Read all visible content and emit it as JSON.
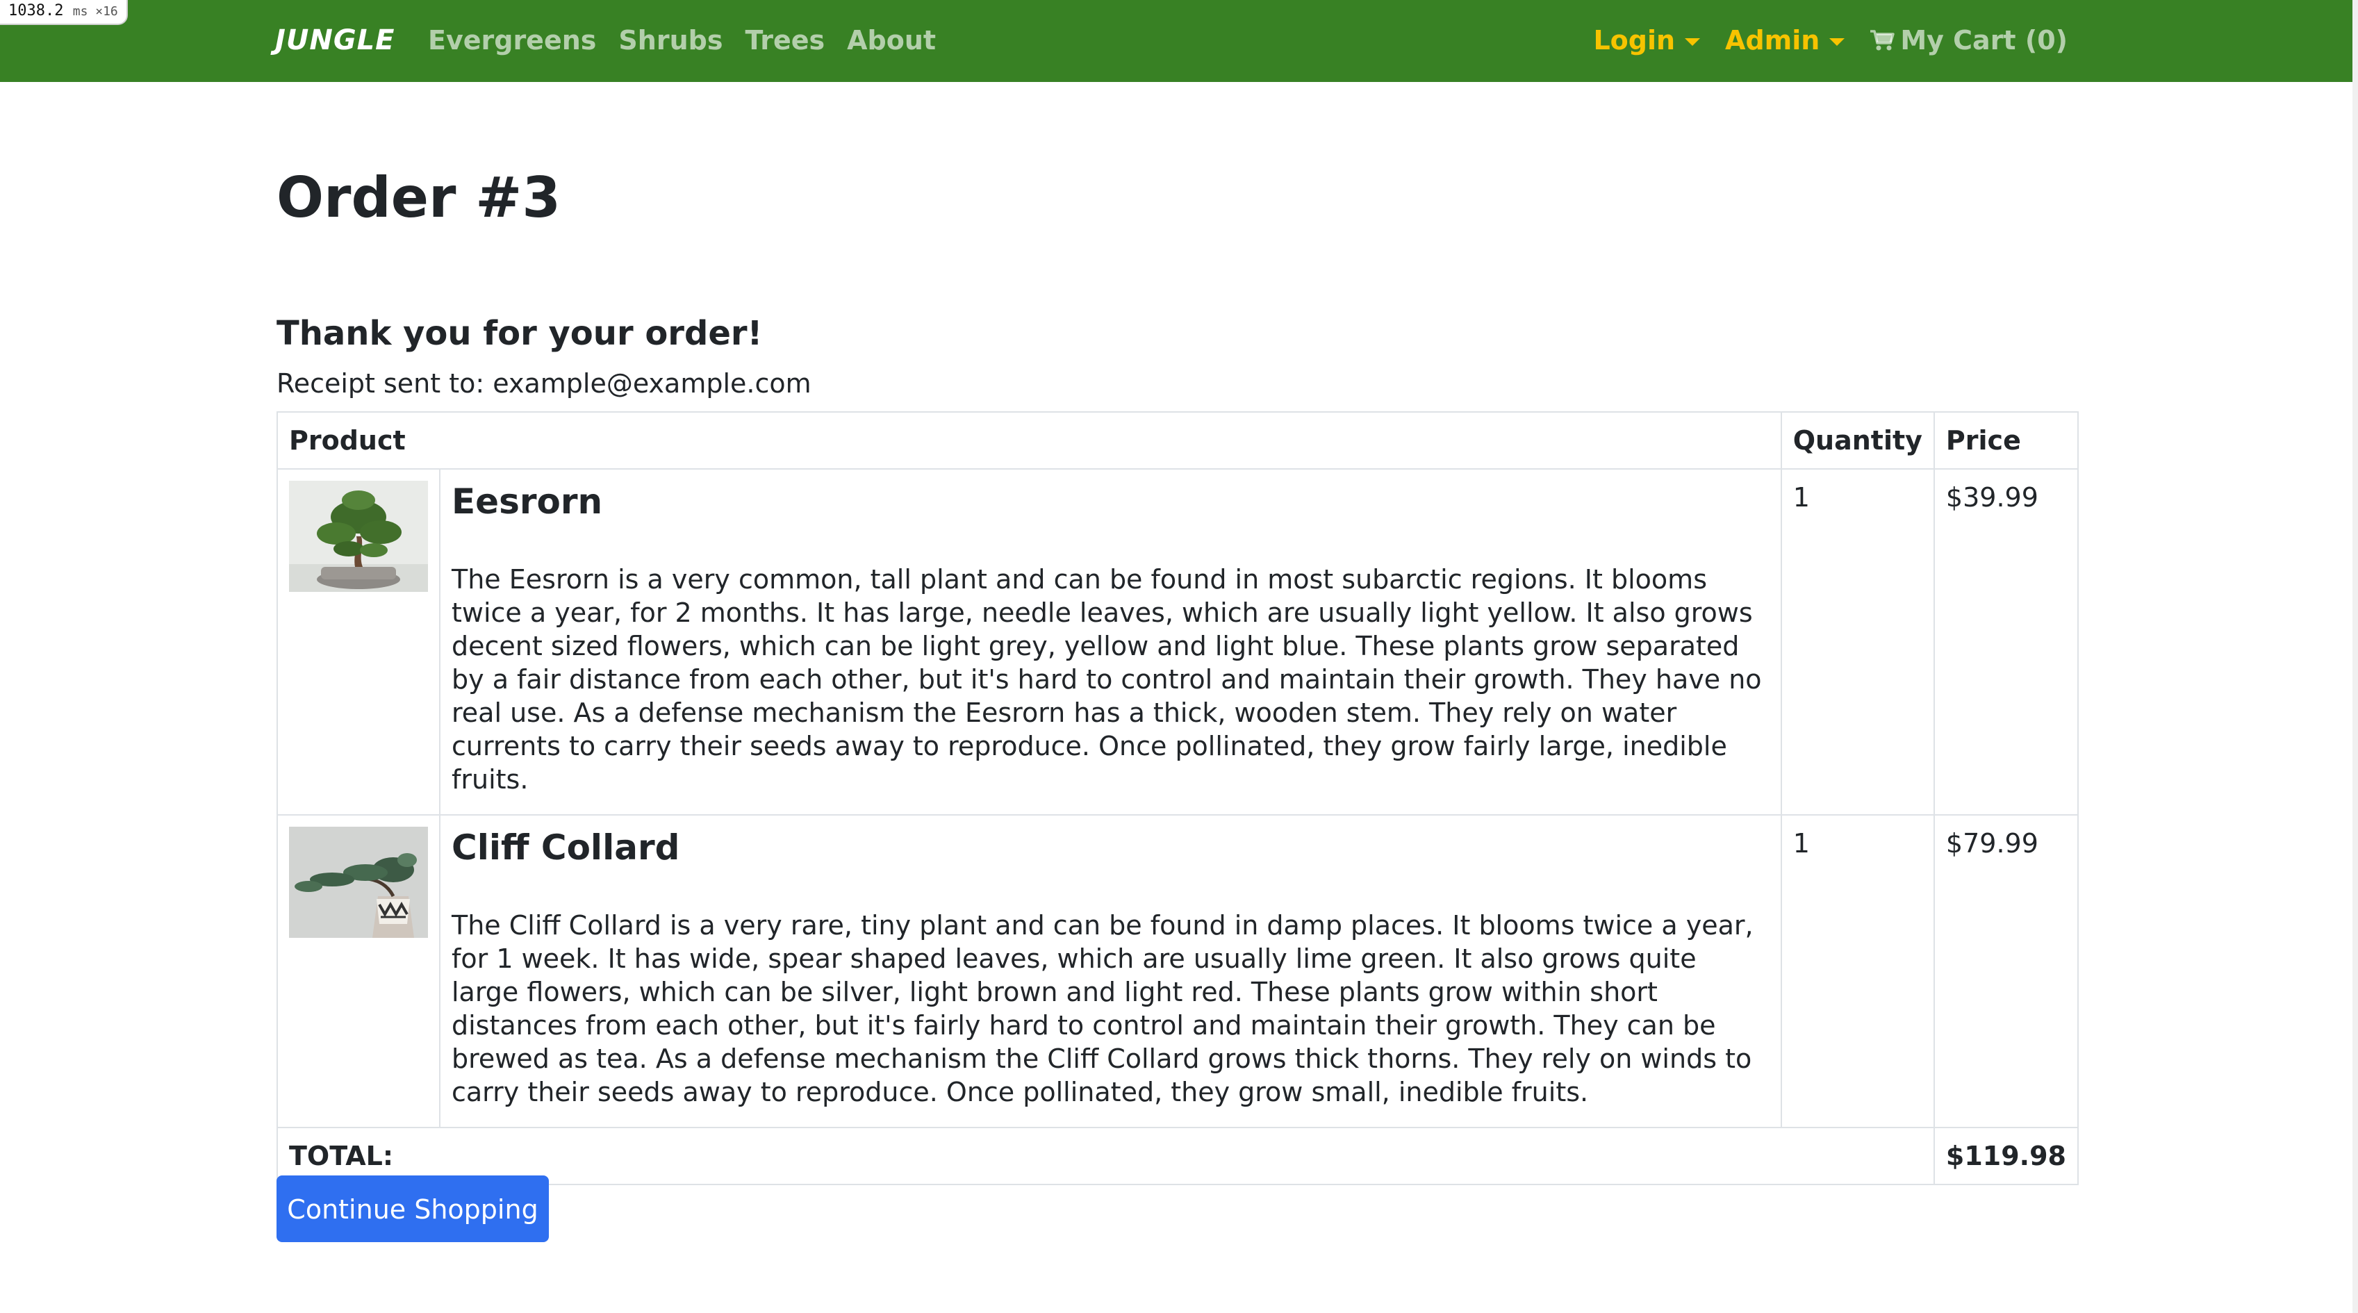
{
  "perf": {
    "value": "1038.2",
    "unit": "ms ×16"
  },
  "nav": {
    "brand": "JUNGLE",
    "links": [
      "Evergreens",
      "Shrubs",
      "Trees",
      "About"
    ],
    "login": "Login",
    "admin": "Admin",
    "cart": "My Cart (0)"
  },
  "colors": {
    "navbar": "#388124",
    "dropdown": "#f7c300",
    "button": "#2f6ff0"
  },
  "page": {
    "title": "Order #3",
    "thanks": "Thank you for your order!",
    "receipt": "Receipt sent to: example@example.com"
  },
  "table": {
    "headers": {
      "product": "Product",
      "quantity": "Quantity",
      "price": "Price"
    },
    "items": [
      {
        "name": "Eesrorn",
        "description": "The Eesrorn is a very common, tall plant and can be found in most subarctic regions. It blooms twice a year, for 2 months. It has large, needle leaves, which are usually light yellow. It also grows decent sized flowers, which can be light grey, yellow and light blue. These plants grow separated by a fair distance from each other, but it's hard to control and maintain their growth. They have no real use. As a defense mechanism the Eesrorn has a thick, wooden stem. They rely on water currents to carry their seeds away to reproduce. Once pollinated, they grow fairly large, inedible fruits.",
        "quantity": "1",
        "price": "$39.99",
        "image": "bonsai-tree-image"
      },
      {
        "name": "Cliff Collard",
        "description": "The Cliff Collard is a very rare, tiny plant and can be found in damp places. It blooms twice a year, for 1 week. It has wide, spear shaped leaves, which are usually lime green. It also grows quite large flowers, which can be silver, light brown and light red. These plants grow within short distances from each other, but it's fairly hard to control and maintain their growth. They can be brewed as tea. As a defense mechanism the Cliff Collard grows thick thorns. They rely on winds to carry their seeds away to reproduce. Once pollinated, they grow small, inedible fruits.",
        "quantity": "1",
        "price": "$79.99",
        "image": "cascade-bonsai-image"
      }
    ],
    "total_label": "TOTAL:",
    "total_value": "$119.98"
  },
  "actions": {
    "continue": "Continue Shopping"
  }
}
